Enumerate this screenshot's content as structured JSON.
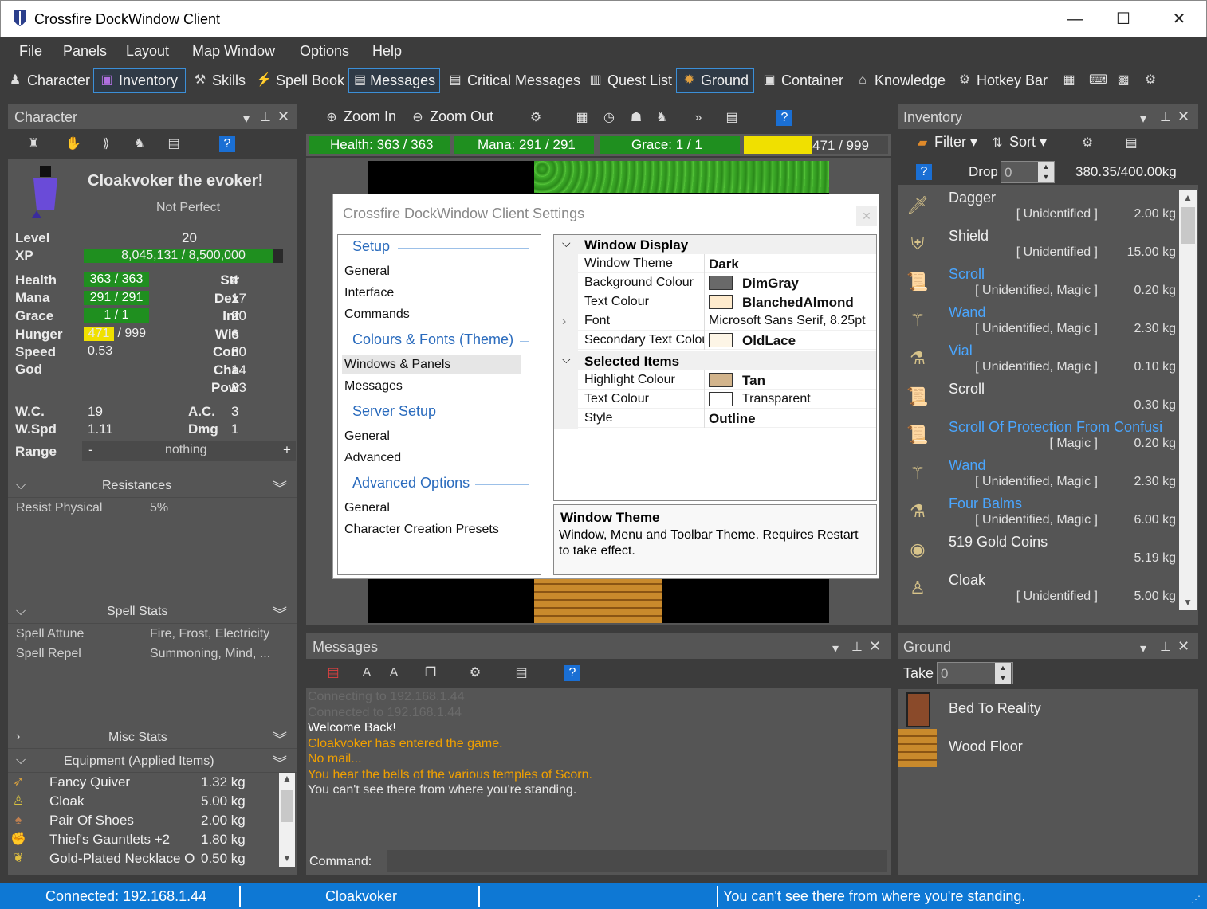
{
  "window": {
    "title": "Crossfire DockWindow Client",
    "minimize": "—",
    "maximize": "☐",
    "close": "✕"
  },
  "menu": [
    "File",
    "Panels",
    "Layout",
    "Map Window",
    "Options",
    "Help"
  ],
  "tabs": [
    "Character",
    "Inventory",
    "Skills",
    "Spell Book",
    "Messages",
    "Critical Messages",
    "Quest List",
    "Ground",
    "Container",
    "Knowledge",
    "Hotkey Bar"
  ],
  "character": {
    "panel_title": "Character",
    "name": "Cloakvoker the evoker!",
    "status": "Not Perfect",
    "level_label": "Level",
    "level": "20",
    "xp_label": "XP",
    "xp": "8,045,131 / 8,500,000",
    "xp_fraction": 0.9465,
    "health_label": "Health",
    "health": "363 / 363",
    "mana_label": "Mana",
    "mana": "291 / 291",
    "grace_label": "Grace",
    "grace": "1 / 1",
    "hunger_label": "Hunger",
    "hunger_val": "471",
    "hunger_max": "/ 999",
    "speed_label": "Speed",
    "speed": "0.53",
    "god_label": "God",
    "stats": [
      {
        "k": "Str",
        "v": "4"
      },
      {
        "k": "Dex",
        "v": "17"
      },
      {
        "k": "Int",
        "v": "20"
      },
      {
        "k": "Wis",
        "v": "6"
      },
      {
        "k": "Con",
        "v": "30"
      },
      {
        "k": "Cha",
        "v": "14"
      },
      {
        "k": "Pow",
        "v": "23"
      }
    ],
    "wc_label": "W.C.",
    "wc": "19",
    "wspd_label": "W.Spd",
    "wspd": "1.11",
    "ac_label": "A.C.",
    "ac": "3",
    "dmg_label": "Dmg",
    "dmg": "1",
    "range_label": "Range",
    "range_minus": "-",
    "range": "nothing",
    "range_plus": "+",
    "resistances_title": "Resistances",
    "resist_name": "Resist Physical",
    "resist_val": "5%",
    "spell_title": "Spell Stats",
    "spell_attune_label": "Spell Attune",
    "spell_attune": "Fire, Frost, Electricity",
    "spell_repel_label": "Spell Repel",
    "spell_repel": "Summoning, Mind, ...",
    "misc_title": "Misc Stats",
    "equip_title": "Equipment (Applied Items)",
    "equipment": [
      {
        "name": "Fancy Quiver",
        "w": "1.32 kg"
      },
      {
        "name": "Cloak",
        "w": "5.00 kg"
      },
      {
        "name": "Pair Of Shoes",
        "w": "2.00 kg"
      },
      {
        "name": "Thief's Gauntlets +2",
        "w": "1.80 kg"
      },
      {
        "name": "Gold-Plated Necklace O",
        "w": "0.50 kg"
      }
    ]
  },
  "map": {
    "zoom_in": "Zoom In",
    "zoom_out": "Zoom Out",
    "health": "Health: 363 / 363",
    "mana": "Mana: 291 / 291",
    "grace": "Grace: 1 / 1",
    "hunger_label": "Hunger",
    "hunger": "471 / 999",
    "hunger_fraction": 0.471
  },
  "settings": {
    "caption": "Crossfire DockWindow Client Settings",
    "nav": [
      {
        "group": "Setup",
        "items": [
          "General",
          "Interface",
          "Commands"
        ]
      },
      {
        "group": "Colours & Fonts (Theme)",
        "items": [
          "Windows & Panels",
          "Messages"
        ]
      },
      {
        "group": "Server Setup",
        "items": [
          "General",
          "Advanced"
        ]
      },
      {
        "group": "Advanced Options",
        "items": [
          "General",
          "Character Creation Presets"
        ]
      }
    ],
    "cat1": "Window Display",
    "cat2": "Selected Items",
    "props": [
      {
        "k": "Window Theme",
        "v": "Dark",
        "color": ""
      },
      {
        "k": "Background Colour",
        "v": "DimGray",
        "color": "#696969"
      },
      {
        "k": "Text Colour",
        "v": "BlanchedAlmond",
        "color": "#ffebcd"
      },
      {
        "k": "Font",
        "v": "Microsoft Sans Serif, 8.25pt",
        "color": ""
      },
      {
        "k": "Secondary Text Colour",
        "v": "OldLace",
        "color": "#fdf5e6"
      }
    ],
    "props2": [
      {
        "k": "Highlight Colour",
        "v": "Tan",
        "color": "#d2b48c"
      },
      {
        "k": "Text Colour",
        "v": "Transparent",
        "color": "#ffffff"
      },
      {
        "k": "Style",
        "v": "Outline",
        "color": ""
      }
    ],
    "desc_title": "Window Theme",
    "desc": "Window, Menu and Toolbar Theme. Requires Restart to take effect."
  },
  "inventory": {
    "panel_title": "Inventory",
    "filter": "Filter",
    "sort": "Sort",
    "drop": "Drop",
    "drop_val": "0",
    "weight": "380.35/400.00kg",
    "items": [
      {
        "name": "Dagger",
        "sub": "[ Unidentified ]",
        "w": "2.00 kg",
        "blue": false
      },
      {
        "name": "Shield",
        "sub": "[ Unidentified ]",
        "w": "15.00 kg",
        "blue": false
      },
      {
        "name": "Scroll",
        "sub": "[ Unidentified, Magic ]",
        "w": "0.20 kg",
        "blue": true
      },
      {
        "name": "Wand",
        "sub": "[ Unidentified, Magic ]",
        "w": "2.30 kg",
        "blue": true
      },
      {
        "name": "Vial",
        "sub": "[ Unidentified, Magic ]",
        "w": "0.10 kg",
        "blue": true
      },
      {
        "name": "Scroll",
        "sub": "",
        "w": "0.30 kg",
        "blue": false
      },
      {
        "name": "Scroll Of Protection From Confusi",
        "sub": "[ Magic ]",
        "w": "0.20 kg",
        "blue": true
      },
      {
        "name": "Wand",
        "sub": "[ Unidentified, Magic ]",
        "w": "2.30 kg",
        "blue": true
      },
      {
        "name": "Four Balms",
        "sub": "[ Unidentified, Magic ]",
        "w": "6.00 kg",
        "blue": true
      },
      {
        "name": "519 Gold Coins",
        "sub": "",
        "w": "5.19 kg",
        "blue": false
      },
      {
        "name": "Cloak",
        "sub": "[ Unidentified ]",
        "w": "5.00 kg",
        "blue": false
      }
    ]
  },
  "messages": {
    "panel_title": "Messages",
    "command_label": "Command:",
    "lines": [
      {
        "text": "Connecting to 192.168.1.44",
        "color": "#6a6a6a"
      },
      {
        "text": "Connected to 192.168.1.44",
        "color": "#6a6a6a"
      },
      {
        "text": "Welcome Back!",
        "color": "#ffffff"
      },
      {
        "text": "Cloakvoker has entered the game.",
        "color": "#f0a000"
      },
      {
        "text": "No mail...",
        "color": "#f0a000"
      },
      {
        "text": "You hear the bells of the various temples of Scorn.",
        "color": "#f0a000"
      },
      {
        "text": "You can't see there from where you're standing.",
        "color": "#e6e6e6"
      }
    ]
  },
  "ground": {
    "panel_title": "Ground",
    "take": "Take",
    "take_val": "0",
    "items": [
      "Bed To Reality",
      "Wood Floor"
    ]
  },
  "status": {
    "connected": "Connected: 192.168.1.44",
    "player": "Cloakvoker",
    "message": "You can't see there from where you're standing."
  }
}
